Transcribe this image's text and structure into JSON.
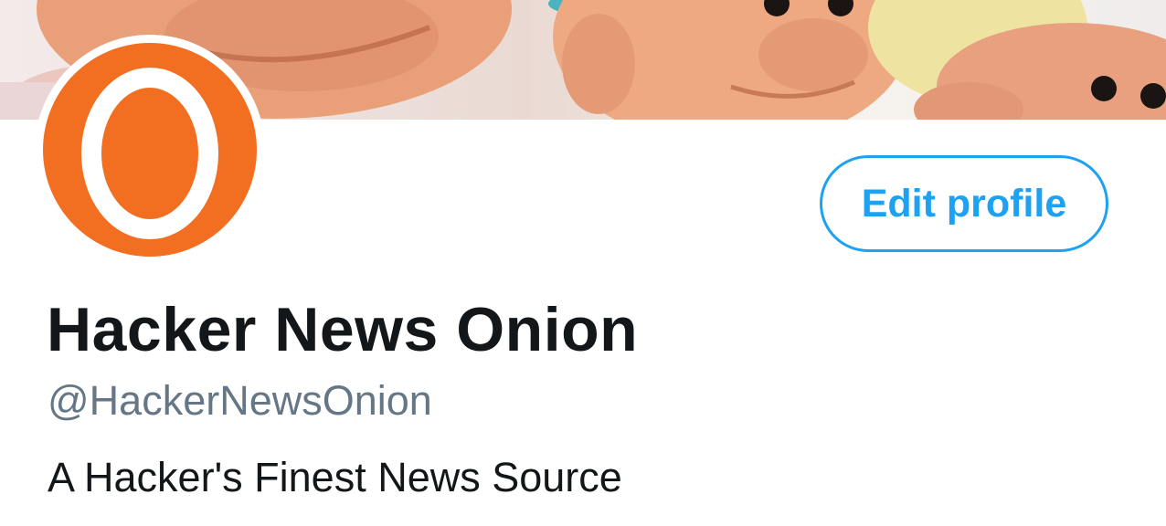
{
  "profile": {
    "display_name": "Hacker News Onion",
    "handle": "@HackerNewsOnion",
    "bio": "A Hacker's Finest News Source",
    "avatar_letter": "O"
  },
  "actions": {
    "edit_profile_label": "Edit profile"
  },
  "colors": {
    "accent": "#1da1f2",
    "avatar_bg": "#f26f21",
    "name_text": "#14171a",
    "handle_text": "#657786"
  }
}
